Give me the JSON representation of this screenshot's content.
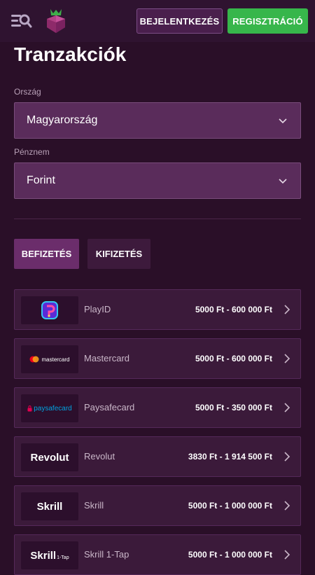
{
  "header": {
    "login_label": "BEJELENTKEZÉS",
    "register_label": "REGISZTRÁCIÓ"
  },
  "page": {
    "title": "Tranzakciók"
  },
  "filters": {
    "country_label": "Ország",
    "country_value": "Magyarország",
    "currency_label": "Pénznem",
    "currency_value": "Forint"
  },
  "tabs": {
    "deposit": "BEFIZETÉS",
    "withdraw": "KIFIZETÉS"
  },
  "payment_methods": [
    {
      "name": "PlayID",
      "range": "5000 Ft - 600 000 Ft",
      "icon": "playid-logo"
    },
    {
      "name": "Mastercard",
      "range": "5000 Ft - 600 000 Ft",
      "icon": "mastercard-logo",
      "logo_text": "mastercard"
    },
    {
      "name": "Paysafecard",
      "range": "5000 Ft - 350 000 Ft",
      "icon": "paysafecard-logo",
      "logo_text": "paysafecard"
    },
    {
      "name": "Revolut",
      "range": "3830 Ft - 1 914 500 Ft",
      "icon": "revolut-logo",
      "logo_text": "Revolut"
    },
    {
      "name": "Skrill",
      "range": "5000 Ft - 1 000 000 Ft",
      "icon": "skrill-logo",
      "logo_text": "Skrill"
    },
    {
      "name": "Skrill 1-Tap",
      "range": "5000 Ft - 1 000 000 Ft",
      "icon": "skrill-1tap-logo",
      "logo_text": "Skrill",
      "logo_subtext": "1-Tap"
    }
  ],
  "colors": {
    "background": "#2a0f28",
    "header": "#2f1330",
    "register_green": "#37b64b",
    "select_bg": "#5a2c5b",
    "row_bg": "#3b1a3a"
  }
}
